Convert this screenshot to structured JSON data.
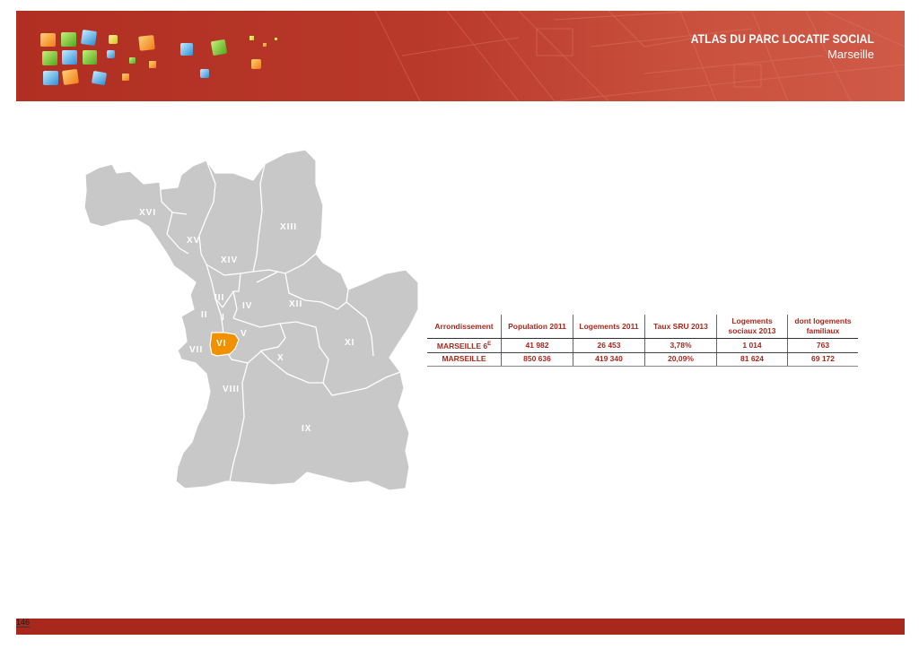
{
  "header": {
    "title": "ATLAS DU PARC LOCATIF SOCIAL",
    "subtitle": "Marseille",
    "color": "#b02f22"
  },
  "map": {
    "highlight_color": "#f29100",
    "base_color": "#c8c8c8",
    "districts": [
      "XVI",
      "XV",
      "XIV",
      "XIII",
      "III",
      "IV",
      "XII",
      "II",
      "I",
      "V",
      "VI",
      "VII",
      "XI",
      "X",
      "VIII",
      "IX"
    ]
  },
  "table": {
    "headers": [
      "Arrondissement",
      "Population 2011",
      "Logements 2011",
      "Taux SRU 2013",
      "Logements sociaux 2013",
      "dont logements familiaux"
    ],
    "rows": [
      {
        "name": "MARSEILLE 6",
        "sup": "E",
        "values": [
          "41 982",
          "26 453",
          "3,78%",
          "1 014",
          "763"
        ]
      },
      {
        "name": "MARSEILLE",
        "sup": "",
        "values": [
          "850 636",
          "419 340",
          "20,09%",
          "81 624",
          "69 172"
        ]
      }
    ]
  },
  "footer": {
    "page_number": "146"
  }
}
